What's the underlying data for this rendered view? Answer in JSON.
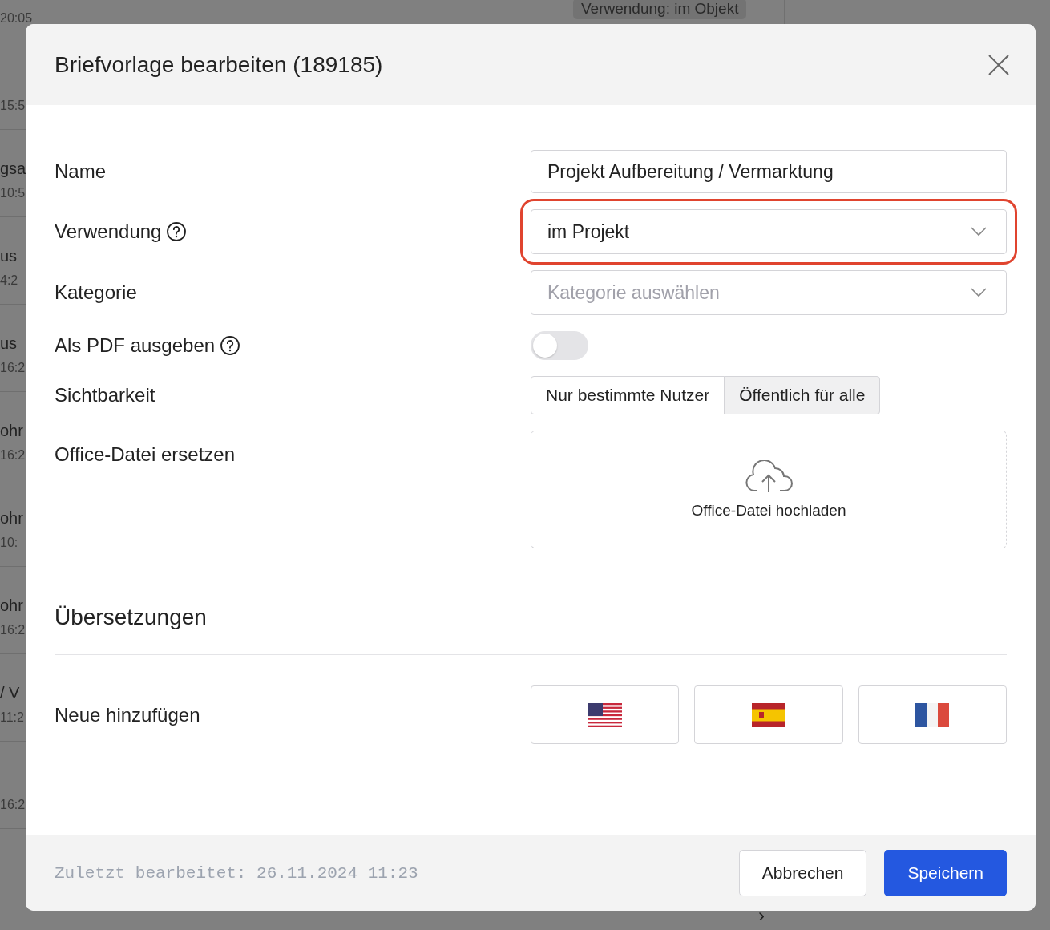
{
  "background": {
    "badge": "Verwendung: im Objekt",
    "chevron": "›",
    "rows": [
      {
        "time": "20:05"
      },
      {
        "time": "15:5"
      },
      {
        "title": "gsa",
        "time": "10:5"
      },
      {
        "title": "us",
        "time": "4:2"
      },
      {
        "title": "us",
        "time": "16:2"
      },
      {
        "title": "ohr",
        "time": "16:2"
      },
      {
        "title": "ohr",
        "time": "10:"
      },
      {
        "title": "ohr",
        "time": "16:2"
      },
      {
        "title": "/ V",
        "time": "11:2"
      },
      {
        "time": "16:2"
      }
    ]
  },
  "dialog": {
    "title": "Briefvorlage bearbeiten (189185)",
    "fields": [
      {
        "kind": "input",
        "label": "Name",
        "value": "Projekt Aufbereitung / Vermarktung"
      },
      {
        "kind": "select",
        "label": "Verwendung",
        "help": true,
        "highlighted": true,
        "value": "im Projekt"
      },
      {
        "kind": "select",
        "label": "Kategorie",
        "placeholder": "Kategorie auswählen"
      },
      {
        "kind": "toggle",
        "label": "Als PDF ausgeben",
        "help": true,
        "on": false
      },
      {
        "kind": "segmented",
        "label": "Sichtbarkeit",
        "options": [
          {
            "label": "Nur bestimmte Nutzer",
            "selected": false
          },
          {
            "label": "Öffentlich für alle",
            "selected": true
          }
        ]
      },
      {
        "kind": "upload",
        "label": "Office-Datei ersetzen",
        "button": "Office-Datei hochladen"
      }
    ],
    "translations": {
      "heading": "Übersetzungen",
      "label": "Neue hinzufügen",
      "flags": [
        {
          "kind": "us"
        },
        {
          "kind": "es"
        },
        {
          "kind": "fr"
        }
      ]
    },
    "footer": {
      "last_edited": "Zuletzt bearbeitet: 26.11.2024 11:23",
      "buttons": [
        {
          "label": "Abbrechen",
          "kind": "secondary"
        },
        {
          "label": "Speichern",
          "kind": "primary"
        }
      ]
    }
  }
}
